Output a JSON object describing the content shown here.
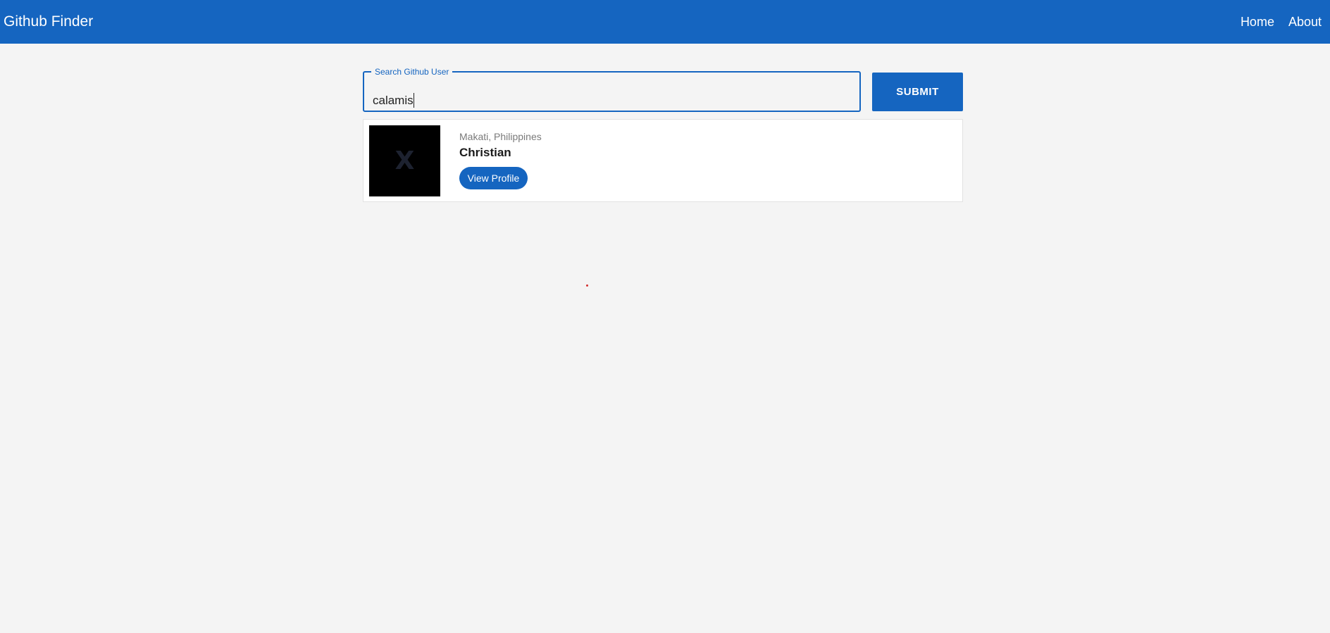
{
  "navbar": {
    "brand": "Github Finder",
    "links": [
      {
        "label": "Home"
      },
      {
        "label": "About"
      }
    ],
    "color": "#1565c0"
  },
  "search": {
    "label": "Search Github User",
    "value": "calamis",
    "submit_label": "SUBMIT"
  },
  "results": [
    {
      "avatar_letter": "X",
      "location": "Makati, Philippines",
      "name": "Christian",
      "button_label": "View Profile"
    }
  ]
}
